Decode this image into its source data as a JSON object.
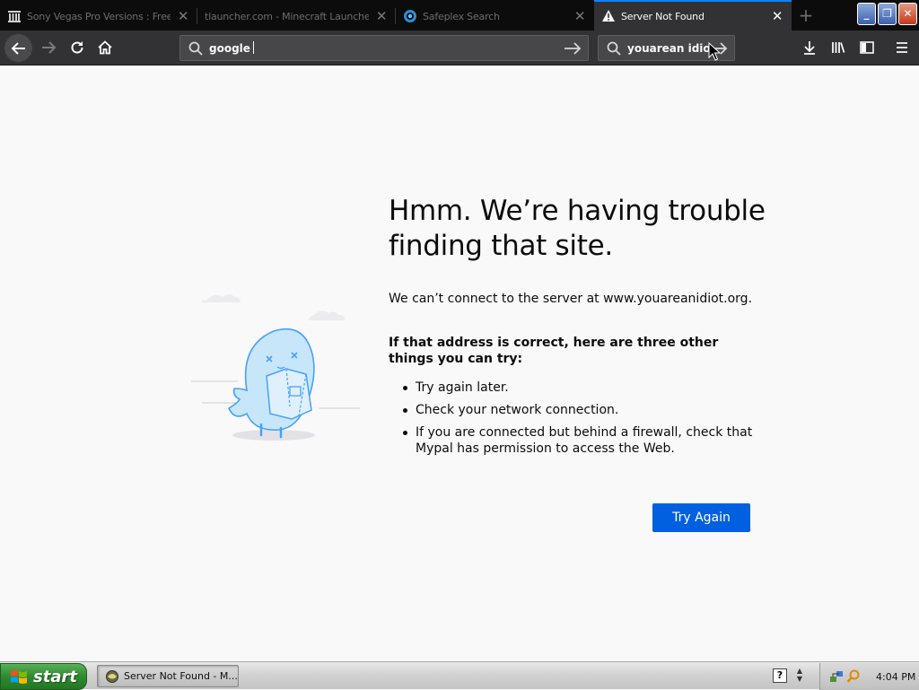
{
  "browser": {
    "tabs": [
      {
        "title": "Sony Vegas Pro Versions : Free ",
        "favicon": "archive-icon",
        "active": false
      },
      {
        "title": "tlauncher.com - Minecraft Launcher fo",
        "favicon": "none",
        "active": false
      },
      {
        "title": "Safeplex Search",
        "favicon": "safeplex-icon",
        "active": false
      },
      {
        "title": "Server Not Found",
        "favicon": "warning-icon",
        "active": true
      }
    ],
    "new_tab_label": "+",
    "window_controls": {
      "minimize": "_",
      "maximize": "❐",
      "close": "✕"
    }
  },
  "toolbar": {
    "url_value": "google",
    "search_value": "youarean idiot"
  },
  "error_page": {
    "title": "Hmm. We’re having trouble finding that site.",
    "description": "We can’t connect to the server at www.youareanidiot.org.",
    "tips_heading": "If that address is correct, here are three other things you can try:",
    "tips": [
      "Try again later.",
      "Check your network connection.",
      "If you are connected but behind a firewall, check that Mypal has permission to access the Web."
    ],
    "try_again_label": "Try Again"
  },
  "taskbar": {
    "start_label": "start",
    "window_button_label": "Server Not Found - M...",
    "help_label": "?",
    "clock": "4:04 PM"
  },
  "colors": {
    "accent": "#0a84ff",
    "button_primary": "#0060df",
    "page_background": "#f9f9fa",
    "chrome_dark": "#0c0c0d",
    "toolbar": "#323234"
  }
}
